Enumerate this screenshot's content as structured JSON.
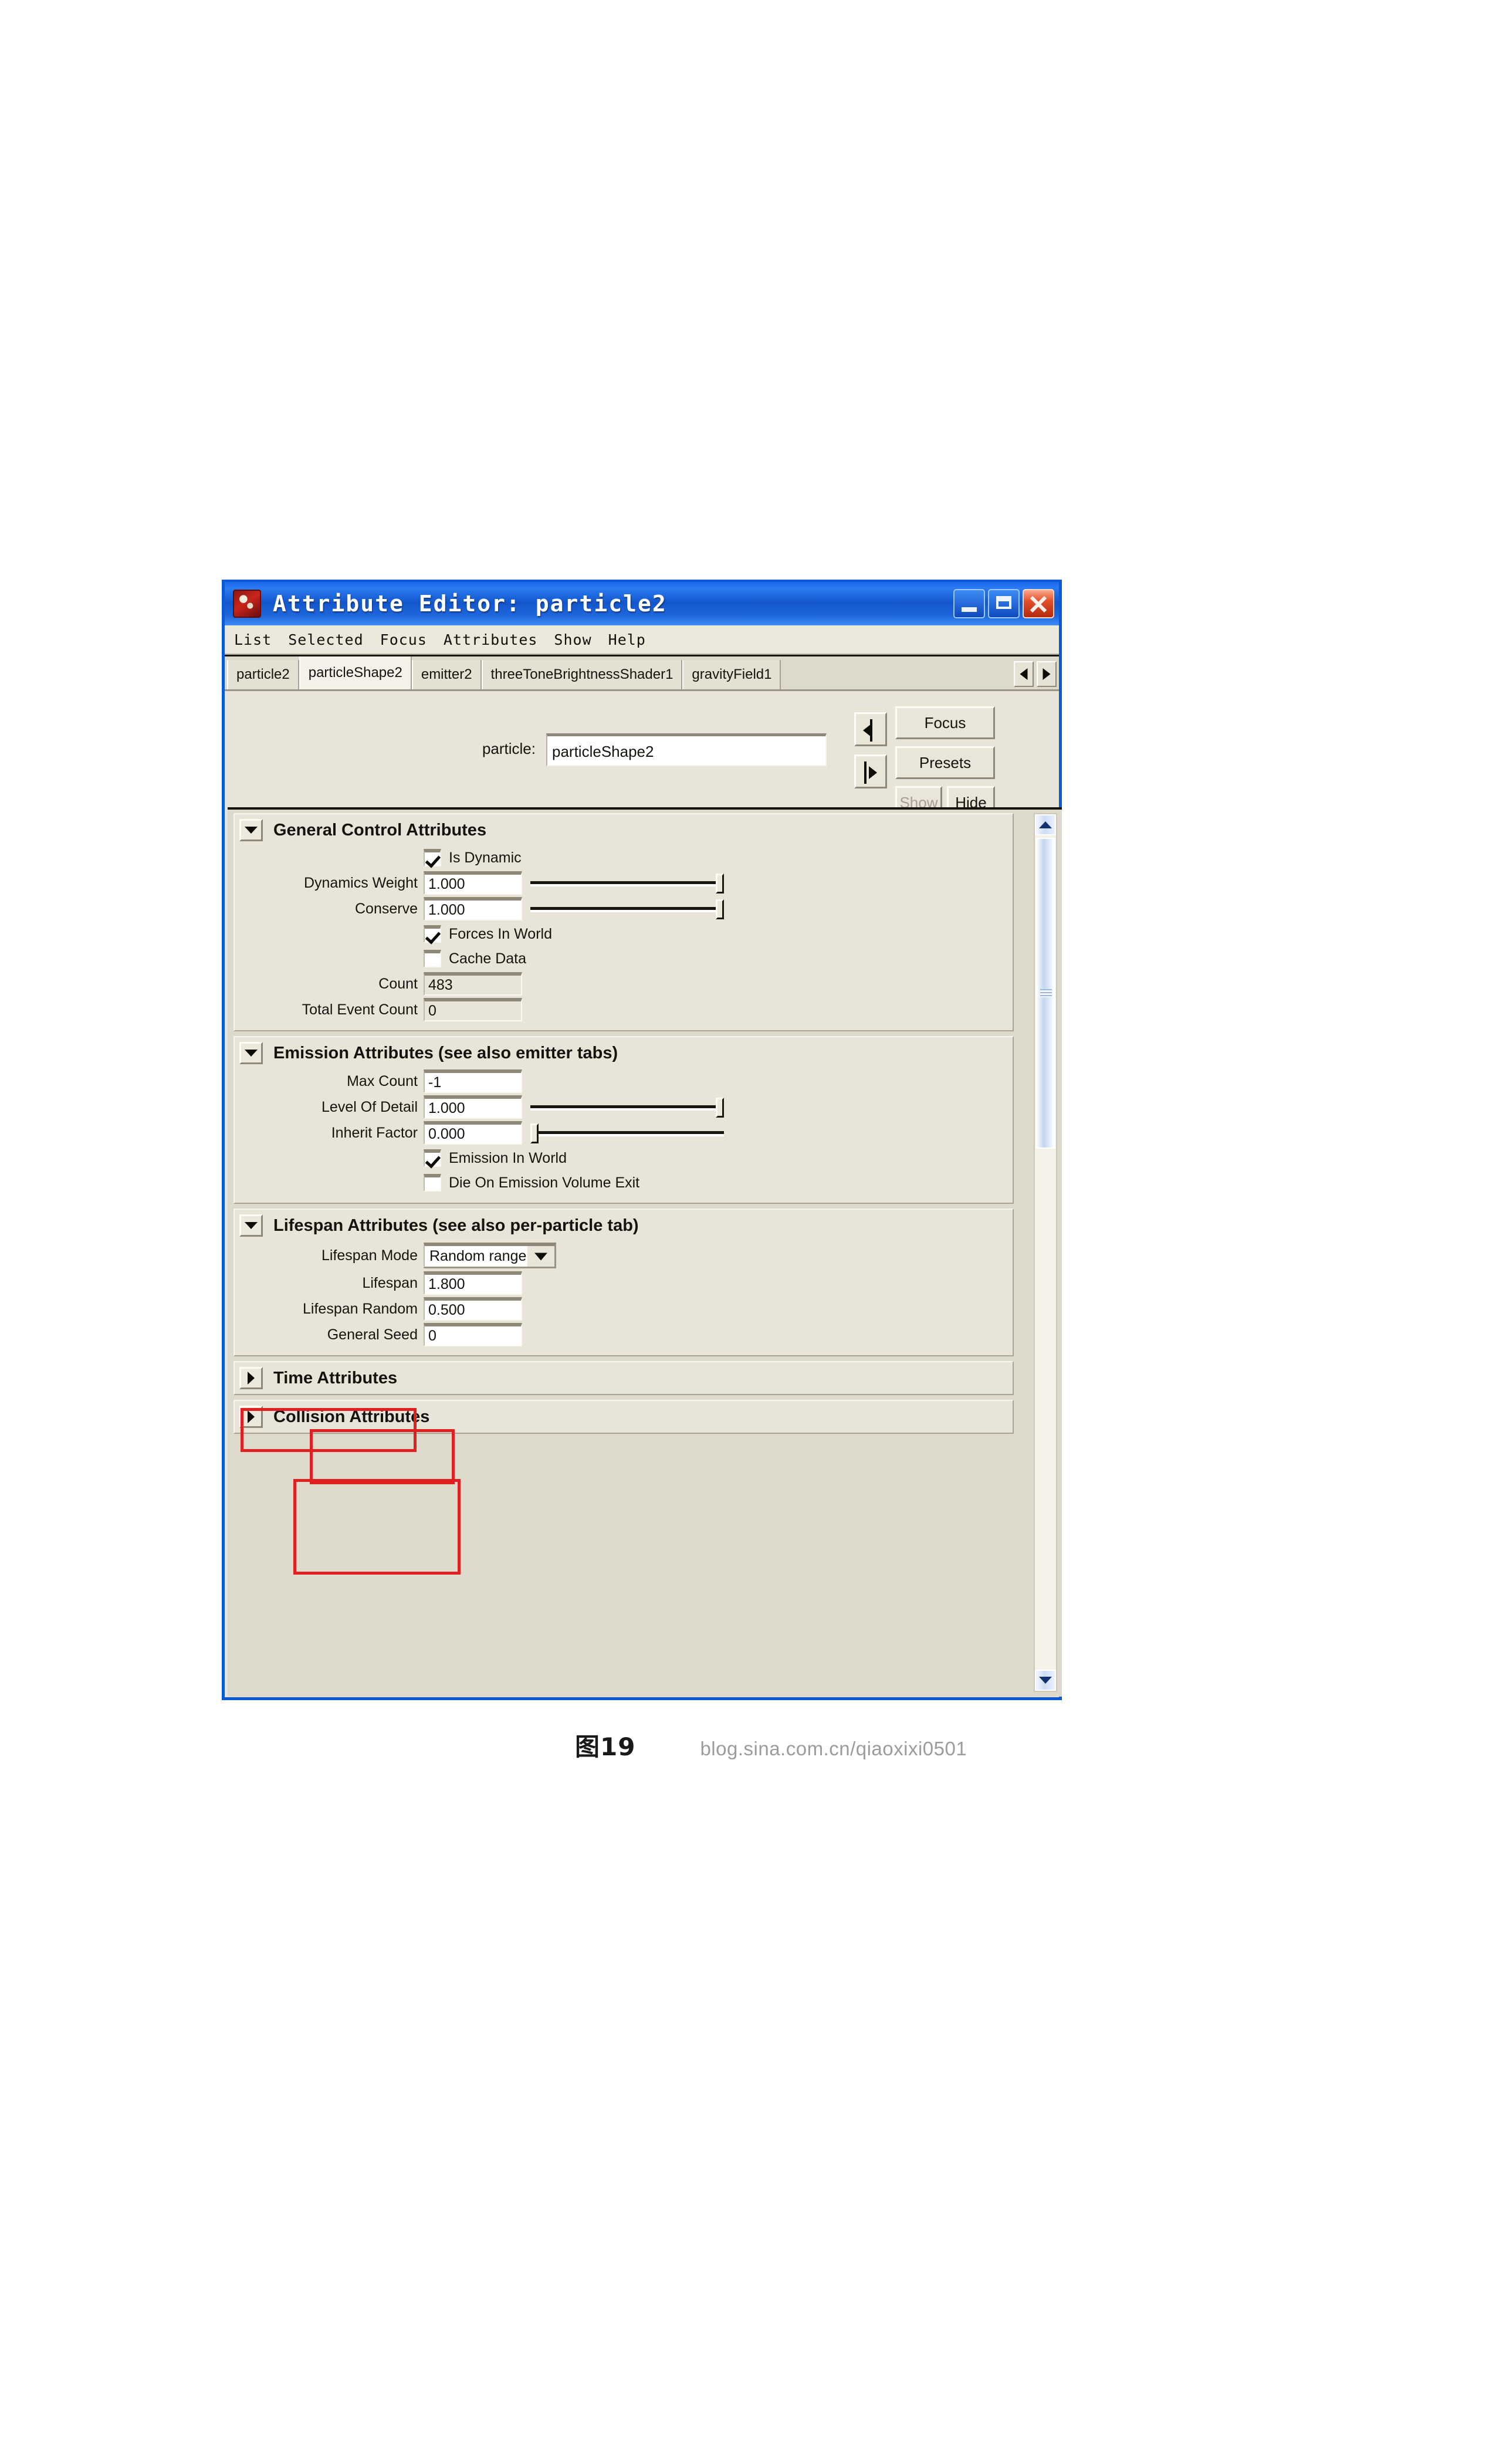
{
  "window": {
    "title": "Attribute Editor: particle2",
    "icon": "maya-app-icon",
    "controls": {
      "minimize": "minimize-button",
      "maximize": "maximize-button",
      "close": "close-button"
    }
  },
  "menu": {
    "items": [
      "List",
      "Selected",
      "Focus",
      "Attributes",
      "Show",
      "Help"
    ]
  },
  "tabs": {
    "items": [
      {
        "label": "particle2",
        "active": false
      },
      {
        "label": "particleShape2",
        "active": true
      },
      {
        "label": "emitter2",
        "active": false
      },
      {
        "label": "threeToneBrightnessShader1",
        "active": false
      },
      {
        "label": "gravityField1",
        "active": false
      }
    ],
    "scroll_left": "◀",
    "scroll_right": "▶"
  },
  "node_header": {
    "label": "particle:",
    "value": "particleShape2",
    "buttons": {
      "focus": "Focus",
      "presets": "Presets",
      "show": "Show",
      "hide": "Hide"
    }
  },
  "sections": [
    {
      "id": "general-control",
      "title": "General Control Attributes",
      "expanded": true,
      "rows": [
        {
          "kind": "checkbox",
          "label": "Is Dynamic",
          "checked": true
        },
        {
          "kind": "slider",
          "label": "Dynamics Weight",
          "value": "1.000",
          "position": "max"
        },
        {
          "kind": "slider",
          "label": "Conserve",
          "value": "1.000",
          "position": "max"
        },
        {
          "kind": "checkbox",
          "label": "Forces In World",
          "checked": true
        },
        {
          "kind": "checkbox",
          "label": "Cache Data",
          "checked": false
        },
        {
          "kind": "field",
          "label": "Count",
          "value": "483",
          "readonly": true
        },
        {
          "kind": "field",
          "label": "Total Event Count",
          "value": "0",
          "readonly": true
        }
      ]
    },
    {
      "id": "emission",
      "title": "Emission Attributes (see also emitter tabs)",
      "expanded": true,
      "rows": [
        {
          "kind": "field",
          "label": "Max Count",
          "value": "-1",
          "readonly": false
        },
        {
          "kind": "slider",
          "label": "Level Of Detail",
          "value": "1.000",
          "position": "max"
        },
        {
          "kind": "slider",
          "label": "Inherit Factor",
          "value": "0.000",
          "position": "min"
        },
        {
          "kind": "checkbox",
          "label": "Emission In World",
          "checked": true
        },
        {
          "kind": "checkbox",
          "label": "Die On Emission Volume Exit",
          "checked": false
        }
      ]
    },
    {
      "id": "lifespan",
      "title": "Lifespan Attributes (see also per-particle tab)",
      "expanded": true,
      "rows": [
        {
          "kind": "dropdown",
          "label": "Lifespan Mode",
          "value": "Random range"
        },
        {
          "kind": "field",
          "label": "Lifespan",
          "value": "1.800",
          "readonly": false
        },
        {
          "kind": "field",
          "label": "Lifespan Random",
          "value": "0.500",
          "readonly": false
        },
        {
          "kind": "field",
          "label": "General Seed",
          "value": "0",
          "readonly": false
        }
      ]
    },
    {
      "id": "time",
      "title": "Time Attributes",
      "expanded": false,
      "rows": []
    },
    {
      "id": "collision",
      "title": "Collision Attributes",
      "expanded": false,
      "rows": []
    }
  ],
  "annotations": {
    "color": "#e02020",
    "boxes": [
      {
        "name": "lifespan-section-highlight"
      },
      {
        "name": "lifespan-mode-highlight"
      },
      {
        "name": "lifespan-values-highlight"
      }
    ]
  },
  "caption": {
    "figure": "图19",
    "watermark": "blog.sina.com.cn/qiaoxixi0501"
  }
}
